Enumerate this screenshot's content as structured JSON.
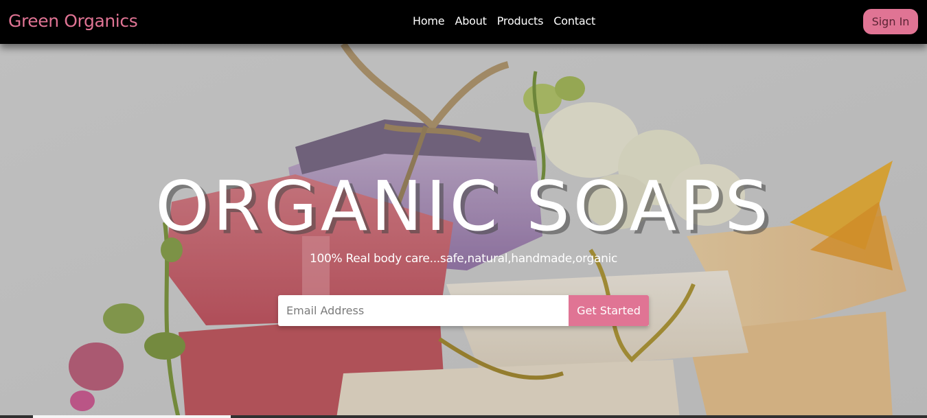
{
  "navbar": {
    "brand": "Green Organics",
    "links": [
      "Home",
      "About",
      "Products",
      "Contact"
    ],
    "signin_label": "Sign In"
  },
  "hero": {
    "title": "ORGANIC SOAPS",
    "subtitle": "100% Real body care...safe,natural,handmade,organic",
    "email_placeholder": "Email Address",
    "cta_label": "Get Started"
  },
  "colors": {
    "accent": "#e07494",
    "navbar_bg": "#000000",
    "text_light": "#ffffff"
  },
  "icons": {
    "hero_image": "soap-bars-photo"
  }
}
